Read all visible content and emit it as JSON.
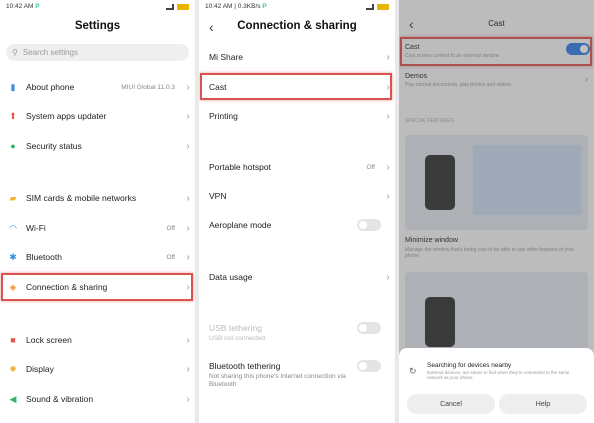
{
  "panel1": {
    "status": {
      "time": "10:42 AM",
      "battery": "84"
    },
    "title": "Settings",
    "search_placeholder": "Search settings",
    "items": [
      {
        "label": "About phone",
        "value": "MIUI Global 11.0.3",
        "icon": "phone-icon",
        "color": "#4a90e2"
      },
      {
        "label": "System apps updater",
        "value": "",
        "icon": "arrow-up-icon",
        "color": "#e85a4f"
      },
      {
        "label": "Security status",
        "value": "",
        "icon": "shield-check-icon",
        "color": "#35b36b"
      },
      {
        "label": "SIM cards & mobile networks",
        "value": "",
        "icon": "sim-icon",
        "color": "#f2b134"
      },
      {
        "label": "Wi-Fi",
        "value": "Off",
        "icon": "wifi-icon",
        "color": "#3b8de3"
      },
      {
        "label": "Bluetooth",
        "value": "Off",
        "icon": "bluetooth-icon",
        "color": "#3b8de3"
      },
      {
        "label": "Connection & sharing",
        "value": "",
        "icon": "connection-icon",
        "color": "#f08c2e"
      },
      {
        "label": "Lock screen",
        "value": "",
        "icon": "lock-icon",
        "color": "#e85a4f"
      },
      {
        "label": "Display",
        "value": "",
        "icon": "sun-icon",
        "color": "#f2b134"
      },
      {
        "label": "Sound & vibration",
        "value": "",
        "icon": "speaker-icon",
        "color": "#35b36b"
      }
    ]
  },
  "panel2": {
    "status": {
      "time": "10:42 AM | 0.3KB/s",
      "battery": "84"
    },
    "title": "Connection & sharing",
    "items": {
      "mi_share": "Mi Share",
      "cast": "Cast",
      "printing": "Printing",
      "hotspot": "Portable hotspot",
      "hotspot_value": "Off",
      "vpn": "VPN",
      "aeroplane": "Aeroplane mode",
      "data_usage": "Data usage",
      "usb": "USB tethering",
      "usb_sub": "USB not connected",
      "bt_tether": "Bluetooth tethering",
      "bt_tether_sub": "Not sharing this phone's Internet connection via Bluetooth"
    }
  },
  "panel3": {
    "title": "Cast",
    "cast_label": "Cast",
    "cast_sub": "Cast screen content to an external window",
    "demos": "Demos",
    "demos_sub": "Play tutorial documents, play photos and videos",
    "special": "SPECIAL FEATURES",
    "minimize": "Minimize window",
    "minimize_sub": "Manage the window that's being cast to be able to use other features of your phone",
    "searching": "Searching for devices nearby",
    "searching_sub": "External devices, are easier to find when they're connected to the same network as your phone",
    "cancel": "Cancel",
    "help": "Help"
  },
  "colors": {
    "highlight": "#d9534f",
    "toggle_on": "#2d7be5"
  }
}
